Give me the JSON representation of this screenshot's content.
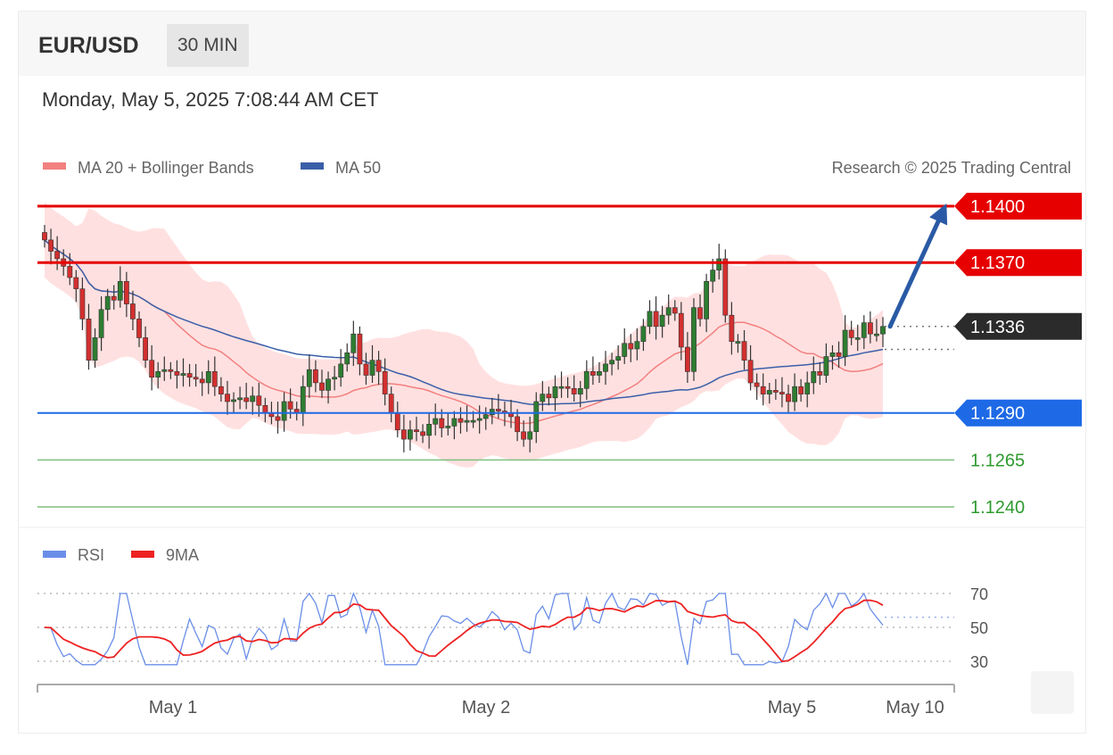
{
  "header": {
    "pair": "EUR/USD",
    "timeframe": "30 MIN",
    "datetime": "Monday, May 5, 2025 7:08:44 AM CET"
  },
  "legend": {
    "ma20": "MA 20 + Bollinger Bands",
    "ma50": "MA 50",
    "copyright": "Research © 2025 Trading Central"
  },
  "rsi_legend": {
    "rsi": "RSI",
    "ma": "9MA"
  },
  "colors": {
    "up": "#2e7d32",
    "down": "#d32f2f",
    "resistance": "#e60000",
    "support": "#1e6ae6",
    "pivot": "#2b2b2b",
    "target_arrow": "#2a5aa5",
    "minor_support": "#2e9a2e",
    "bands": "#ffd6d6",
    "ma20": "#f28080",
    "ma50": "#3a5fa8",
    "rsi": "#6a8ee8",
    "rsi_ma": "#ee2222"
  },
  "chart_data": [
    {
      "type": "candlestick",
      "title": "EUR/USD",
      "timeframe": "30 MIN",
      "x_labels": [
        "May 1",
        "May 2",
        "May 5",
        "May 10"
      ],
      "ylim": [
        1.1225,
        1.1415
      ],
      "levels": [
        {
          "value": 1.14,
          "label": "1.1400",
          "kind": "resistance"
        },
        {
          "value": 1.137,
          "label": "1.1370",
          "kind": "resistance"
        },
        {
          "value": 1.1336,
          "label": "1.1336",
          "kind": "pivot"
        },
        {
          "value": 1.129,
          "label": "1.1290",
          "kind": "support"
        },
        {
          "value": 1.1265,
          "label": "1.1265",
          "kind": "minor-support"
        },
        {
          "value": 1.124,
          "label": "1.1240",
          "kind": "minor-support"
        }
      ],
      "closes": [
        1.1382,
        1.1376,
        1.1372,
        1.1368,
        1.1362,
        1.1356,
        1.134,
        1.1318,
        1.133,
        1.1345,
        1.1352,
        1.135,
        1.136,
        1.1348,
        1.134,
        1.133,
        1.1318,
        1.1309,
        1.1312,
        1.1313,
        1.1312,
        1.131,
        1.1311,
        1.1309,
        1.1308,
        1.1306,
        1.1312,
        1.1304,
        1.13,
        1.1296,
        1.1297,
        1.1298,
        1.1296,
        1.1299,
        1.1294,
        1.129,
        1.1288,
        1.1286,
        1.1296,
        1.1292,
        1.129,
        1.1304,
        1.1313,
        1.1306,
        1.1302,
        1.1308,
        1.1309,
        1.1316,
        1.1322,
        1.1332,
        1.1316,
        1.131,
        1.1318,
        1.1312,
        1.13,
        1.129,
        1.1281,
        1.1276,
        1.1281,
        1.128,
        1.1278,
        1.1284,
        1.1287,
        1.1282,
        1.1283,
        1.1287,
        1.1285,
        1.1286,
        1.1286,
        1.1287,
        1.1289,
        1.1292,
        1.1291,
        1.129,
        1.1288,
        1.128,
        1.1276,
        1.128,
        1.1296,
        1.13,
        1.1298,
        1.1304,
        1.1304,
        1.1303,
        1.13,
        1.1303,
        1.1312,
        1.131,
        1.1312,
        1.1316,
        1.1318,
        1.132,
        1.1327,
        1.1324,
        1.1328,
        1.1336,
        1.1344,
        1.1336,
        1.1342,
        1.1346,
        1.1343,
        1.1325,
        1.1312,
        1.1346,
        1.134,
        1.136,
        1.1366,
        1.1372,
        1.1342,
        1.1328,
        1.1328,
        1.1318,
        1.1306,
        1.1304,
        1.13,
        1.1302,
        1.1301,
        1.13,
        1.1296,
        1.1304,
        1.13,
        1.1306,
        1.1312,
        1.131,
        1.132,
        1.1322,
        1.132,
        1.1334,
        1.133,
        1.133,
        1.1338,
        1.1332,
        1.1332,
        1.1336
      ],
      "rsi": {
        "ylim": [
          20,
          80
        ],
        "levels": [
          70,
          50,
          30
        ],
        "levels_labels": [
          "70",
          "50",
          "30"
        ],
        "rsi_last": 56,
        "rsi_ma_last": 56
      },
      "indicators": [
        "MA 20 + Bollinger Bands",
        "MA 50",
        "RSI",
        "9MA"
      ]
    }
  ]
}
